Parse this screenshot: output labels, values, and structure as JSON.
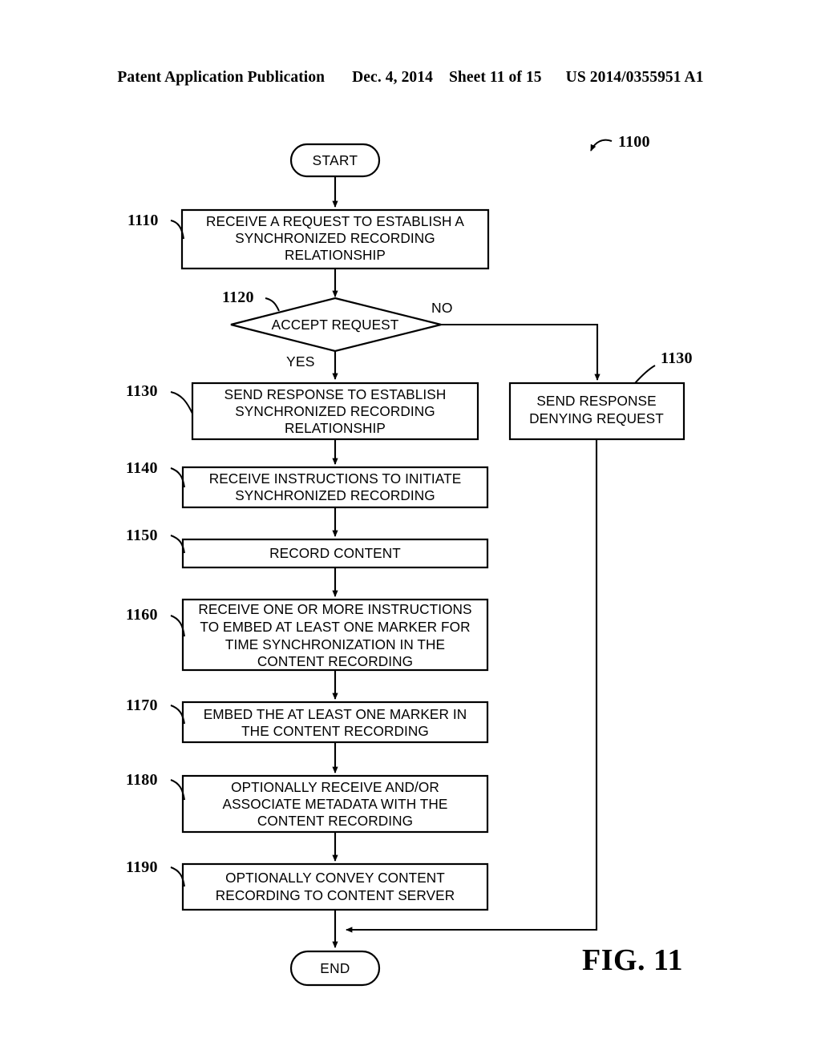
{
  "header": {
    "publication": "Patent Application Publication",
    "date": "Dec. 4, 2014",
    "sheet": "Sheet 11 of 15",
    "patent_number": "US 2014/0355951 A1"
  },
  "figure": {
    "label": "FIG. 11",
    "diagram_ref": "1100"
  },
  "flowchart": {
    "start_label": "START",
    "end_label": "END",
    "decision": {
      "ref": "1120",
      "text": "ACCEPT REQUEST",
      "yes_label": "YES",
      "no_label": "NO"
    },
    "steps": [
      {
        "ref": "1110",
        "lines": [
          "RECEIVE A REQUEST TO ESTABLISH A",
          "SYNCHRONIZED RECORDING",
          "RELATIONSHIP"
        ]
      },
      {
        "ref": "1130",
        "lines": [
          "SEND RESPONSE TO ESTABLISH",
          "SYNCHRONIZED RECORDING",
          "RELATIONSHIP"
        ]
      },
      {
        "ref": "1140",
        "lines": [
          "RECEIVE INSTRUCTIONS TO INITIATE",
          "SYNCHRONIZED RECORDING"
        ]
      },
      {
        "ref": "1150",
        "lines": [
          "RECORD CONTENT"
        ]
      },
      {
        "ref": "1160",
        "lines": [
          "RECEIVE ONE OR MORE INSTRUCTIONS",
          "TO EMBED AT LEAST ONE MARKER FOR",
          "TIME SYNCHRONIZATION IN THE",
          "CONTENT RECORDING"
        ]
      },
      {
        "ref": "1170",
        "lines": [
          "EMBED THE AT LEAST ONE MARKER IN",
          "THE CONTENT RECORDING"
        ]
      },
      {
        "ref": "1180",
        "lines": [
          "OPTIONALLY RECEIVE AND/OR",
          "ASSOCIATE METADATA WITH THE",
          "CONTENT RECORDING"
        ]
      },
      {
        "ref": "1190",
        "lines": [
          "OPTIONALLY CONVEY CONTENT",
          "RECORDING TO CONTENT SERVER"
        ]
      }
    ],
    "deny_branch": {
      "ref": "1130",
      "lines": [
        "SEND RESPONSE",
        "DENYING REQUEST"
      ]
    }
  },
  "colors": {
    "ink": "#000000",
    "paper": "#ffffff"
  }
}
